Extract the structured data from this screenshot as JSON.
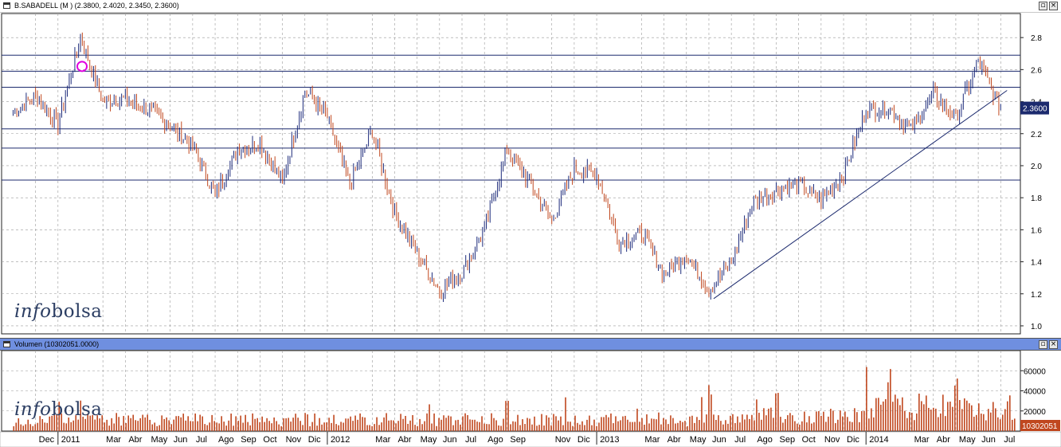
{
  "price_panel": {
    "title": "B.SABADELL (M ) (2.3800, 2.4020, 2.3450, 2.3600)",
    "last_price_label": "2.3600"
  },
  "volume_panel": {
    "title": "Volumen (10302051.0000)",
    "last_volume_label": "10302051"
  },
  "watermark": {
    "part1": "info",
    "part2": "bolsa"
  },
  "window_buttons": {
    "minimize": "▫",
    "close": "×"
  },
  "colors": {
    "candle": "#c0471e",
    "candle_up": "#1c2a7a",
    "grid": "#9a9a9a",
    "hline": "#1c2a6e",
    "trendline": "#1c2a6e",
    "marker": "#e000e0",
    "price_badge": "#1c2a6e",
    "volume_bar": "#c0471e",
    "volume_badge": "#c0471e",
    "title_bar": "#6f8fe0"
  },
  "chart_data": [
    {
      "type": "candlestick",
      "title": "B.SABADELL (M ) (2.3800, 2.4020, 2.3450, 2.3600)",
      "y_range": [
        0.95,
        2.95
      ],
      "y_ticks": [
        "2.8",
        "2.6",
        "2.4",
        "2.2",
        "2.0",
        "1.8",
        "1.6",
        "1.4",
        "1.2",
        "1.0"
      ],
      "y_tick_values": [
        2.8,
        2.6,
        2.4,
        2.2,
        2.0,
        1.8,
        1.6,
        1.4,
        1.2,
        1.0
      ],
      "grid": true,
      "x_ticks": [
        "Dec",
        "2011",
        "Mar",
        "Abr",
        "May",
        "Jun",
        "Jul",
        "Ago",
        "Sep",
        "Oct",
        "Nov",
        "Dic",
        "2012",
        "Mar",
        "Abr",
        "May",
        "Jun",
        "Jul",
        "Ago",
        "Sep",
        "Nov",
        "Dic",
        "2013",
        "Mar",
        "Abr",
        "May",
        "Jun",
        "Jul",
        "Ago",
        "Sep",
        "Oct",
        "Nov",
        "Dic",
        "2014",
        "Mar",
        "Abr",
        "May",
        "Jun",
        "Jul"
      ],
      "horizontal_levels": [
        2.69,
        2.59,
        2.49,
        2.23,
        2.11,
        1.91
      ],
      "trendline": {
        "from": [
          "2013-06",
          1.17
        ],
        "to": [
          "2014-07",
          2.47
        ]
      },
      "marker": {
        "date": "2011-02",
        "value": 2.62
      },
      "close_series": [
        [
          "2010-11",
          2.33
        ],
        [
          "2010-12",
          2.44
        ],
        [
          "2011-01",
          2.26
        ],
        [
          "2011-02",
          2.8
        ],
        [
          "2011-02b",
          2.6
        ],
        [
          "2011-03",
          2.4
        ],
        [
          "2011-04",
          2.42
        ],
        [
          "2011-05",
          2.35
        ],
        [
          "2011-06",
          2.25
        ],
        [
          "2011-07",
          2.12
        ],
        [
          "2011-08",
          1.82
        ],
        [
          "2011-09",
          2.1
        ],
        [
          "2011-10",
          2.14
        ],
        [
          "2011-11",
          1.9
        ],
        [
          "2011-12",
          2.47
        ],
        [
          "2012-01",
          2.3
        ],
        [
          "2012-02",
          1.88
        ],
        [
          "2012-03",
          2.22
        ],
        [
          "2012-04",
          1.7
        ],
        [
          "2012-05",
          1.45
        ],
        [
          "2012-06",
          1.22
        ],
        [
          "2012-07",
          1.33
        ],
        [
          "2012-08",
          1.6
        ],
        [
          "2012-09",
          2.1
        ],
        [
          "2012-10",
          1.9
        ],
        [
          "2012-11",
          1.66
        ],
        [
          "2012-12",
          1.98
        ],
        [
          "2013-01",
          1.95
        ],
        [
          "2013-02",
          1.52
        ],
        [
          "2013-03",
          1.58
        ],
        [
          "2013-04",
          1.32
        ],
        [
          "2013-05",
          1.45
        ],
        [
          "2013-06",
          1.22
        ],
        [
          "2013-07",
          1.4
        ],
        [
          "2013-08",
          1.78
        ],
        [
          "2013-09",
          1.85
        ],
        [
          "2013-10",
          1.88
        ],
        [
          "2013-11",
          1.78
        ],
        [
          "2013-12",
          1.95
        ],
        [
          "2014-01",
          2.35
        ],
        [
          "2014-02",
          2.36
        ],
        [
          "2014-03",
          2.22
        ],
        [
          "2014-04",
          2.45
        ],
        [
          "2014-05",
          2.3
        ],
        [
          "2014-06",
          2.65
        ],
        [
          "2014-07",
          2.36
        ]
      ]
    },
    {
      "type": "bar",
      "title": "Volumen (10302051.0000)",
      "y_range": [
        0,
        80000
      ],
      "y_ticks": [
        "60000",
        "40000",
        "20000"
      ],
      "y_tick_values": [
        60000,
        40000,
        20000
      ],
      "typical_volume": 12000,
      "spikes": [
        [
          "2011-01",
          40000
        ],
        [
          "2011-02",
          33000
        ],
        [
          "2012-09",
          40000
        ],
        [
          "2013-06",
          48000
        ],
        [
          "2013-09",
          45000
        ],
        [
          "2014-01",
          76000
        ],
        [
          "2014-02",
          68000
        ],
        [
          "2014-05",
          55000
        ]
      ]
    }
  ]
}
